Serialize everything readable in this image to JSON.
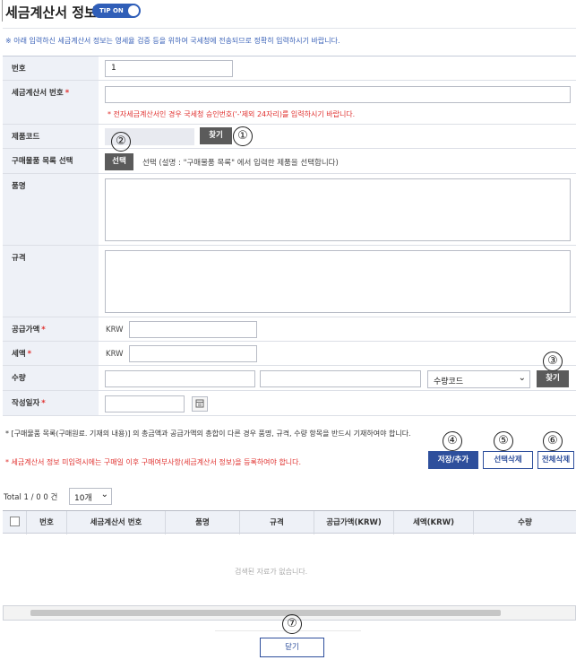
{
  "header": {
    "title": "세금계산서 정보",
    "tip_label": "TIP ON"
  },
  "notice": "※ 아래 입력하신 세금계산서 정보는 영세율 검증 등을 위하여 국세청에 전송되므로 정확히 입력하시기 바랍니다.",
  "form": {
    "seq": {
      "label": "번호",
      "value": "1"
    },
    "invoice_no": {
      "label": "세금계산서 번호",
      "value": "",
      "hint": "* 전자세금계산서인 경우 국세청 승인번호('-'제외 24자리)를 입력하시기 바랍니다."
    },
    "product_code": {
      "label": "제품코드",
      "value": "",
      "find_label": "찾기"
    },
    "purchase_select": {
      "label": "구매물품 목록 선택",
      "button_label": "선택",
      "desc": "선택 (설명 : \"구매물품 목록\" 에서 입력한 제품을 선택합니다)"
    },
    "item_name": {
      "label": "품명",
      "value": ""
    },
    "spec": {
      "label": "규격",
      "value": ""
    },
    "supply_amount": {
      "label": "공급가액",
      "currency": "KRW",
      "value": ""
    },
    "tax_amount": {
      "label": "세액",
      "currency": "KRW",
      "value": ""
    },
    "quantity": {
      "label": "수량",
      "value1": "",
      "value2": "",
      "unit_select": "수량코드",
      "find_label": "찾기"
    },
    "write_date": {
      "label": "작성일자",
      "value": ""
    }
  },
  "notes": {
    "note1": "* [구매물품 목록(구매원료. 기재의 내용)] 의 총금액과 공급가액의 총합이 다른 경우 품명, 규격, 수량 항목을 반드시 기재하여야 합니다.",
    "note2": "* 세금계산서 정보 미입력시에는 구매일 이후 구매여부사항(세금계산서 정보)을 등록하여야 합니다."
  },
  "actions": {
    "save": "저장/추가",
    "delete_selected": "선택삭제",
    "delete_all": "전체삭제"
  },
  "grid": {
    "total_label": "Total 1 / 0   0 건",
    "page_size": "10개",
    "columns": [
      "번호",
      "세금계산서 번호",
      "품명",
      "규격",
      "공급가액(KRW)",
      "세액(KRW)",
      "수량"
    ],
    "empty_text": "검색된 자료가 없습니다."
  },
  "close_label": "닫기",
  "markers": [
    "①",
    "②",
    "③",
    "④",
    "⑤",
    "⑥",
    "⑦"
  ]
}
